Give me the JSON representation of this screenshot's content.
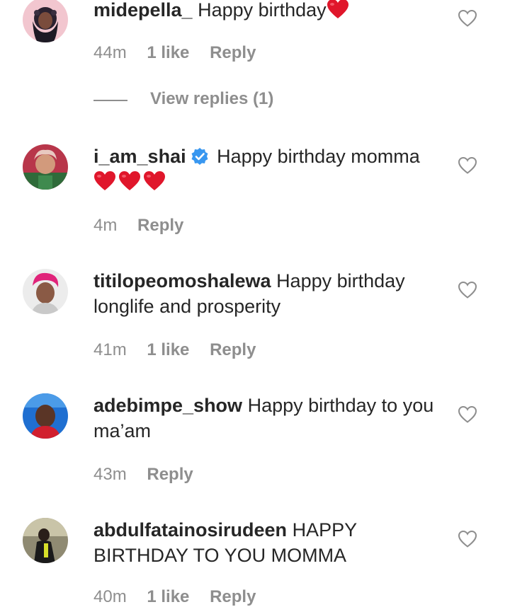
{
  "comments": [
    {
      "username": "midepella_",
      "text": "Happy birthday",
      "hearts": 1,
      "time": "44m",
      "likes": "1 like",
      "reply": "Reply",
      "view_replies": "View replies (1)"
    },
    {
      "username": "i_am_shai",
      "verified": true,
      "text": "Happy birthday momma",
      "hearts": 3,
      "time": "4m",
      "reply": "Reply"
    },
    {
      "username": "titilopeomoshalewa",
      "text": "Happy birthday longlife and prosperity",
      "time": "41m",
      "likes": "1 like",
      "reply": "Reply"
    },
    {
      "username": "adebimpe_show",
      "text": "Happy birthday to you ma’am",
      "time": "43m",
      "reply": "Reply"
    },
    {
      "username": "abdulfatainosirudeen",
      "text": "HAPPY BIRTHDAY TO YOU MOMMA",
      "time": "40m",
      "likes": "1 like",
      "reply": "Reply"
    }
  ],
  "colors": {
    "text": "#262626",
    "meta": "#8e8e8e",
    "verified": "#3897f0",
    "heart_emoji": "#e0162b"
  },
  "icons": {
    "like": "heart-outline-icon",
    "verified": "verified-badge-icon",
    "emoji": "red-heart-emoji-icon"
  }
}
